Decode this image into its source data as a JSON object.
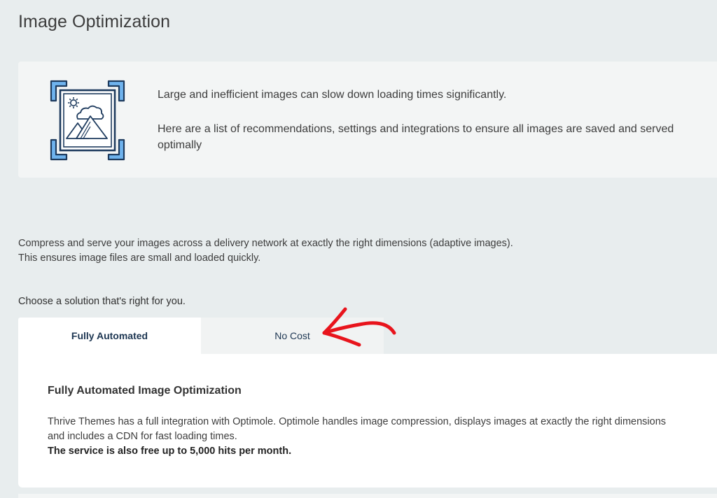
{
  "page": {
    "title": "Image Optimization"
  },
  "intro": {
    "line1": "Large and inefficient images can slow down loading times significantly.",
    "line2": "Here are a list of recommendations, settings and integrations to ensure all images are saved and served optimally",
    "icon": "image-frame-icon"
  },
  "description": {
    "line1": "Compress and serve your images across a delivery network at exactly the right dimensions (adaptive images).",
    "line2": "This ensures image files are small and loaded quickly."
  },
  "choose_label": "Choose a solution that's right for you.",
  "tabs": [
    {
      "label": "Fully Automated",
      "active": true
    },
    {
      "label": "No Cost",
      "active": false
    }
  ],
  "panel": {
    "title": "Fully Automated Image Optimization",
    "body": "Thrive Themes has a full integration with Optimole. Optimole handles image compression, displays images at exactly the right dimensions and includes a CDN for fast loading times.",
    "bold": "The service is also free up to 5,000 hits per month."
  },
  "colors": {
    "background": "#e8edee",
    "card": "#f3f5f5",
    "tab_text": "#1d3652",
    "icon_blue": "#6fb3ee",
    "icon_navy": "#1e3b5e",
    "annotation": "#e8141c"
  }
}
